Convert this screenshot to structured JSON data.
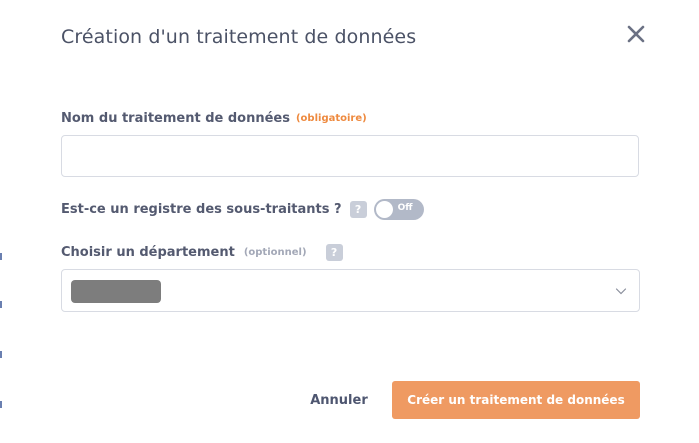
{
  "dialog": {
    "title": "Création d'un traitement de données",
    "close_icon": "close-icon"
  },
  "name_field": {
    "label": "Nom du traitement de données",
    "required_tag": "(obligatoire)",
    "value": "",
    "placeholder": ""
  },
  "subcontractor_registry": {
    "label": "Est-ce un registre des sous-traitants ?",
    "help_glyph": "?",
    "toggle_text": "Off",
    "toggle_on": false
  },
  "department": {
    "label": "Choisir un département",
    "optional_tag": "(optionnel)",
    "help_glyph": "?",
    "selected_value": "redacted"
  },
  "actions": {
    "cancel_label": "Annuler",
    "create_label": "Créer un traitement de données"
  },
  "colors": {
    "accent": "#ef9a62",
    "required": "#ee8a3f",
    "toggle_off": "#b2b9c8"
  }
}
